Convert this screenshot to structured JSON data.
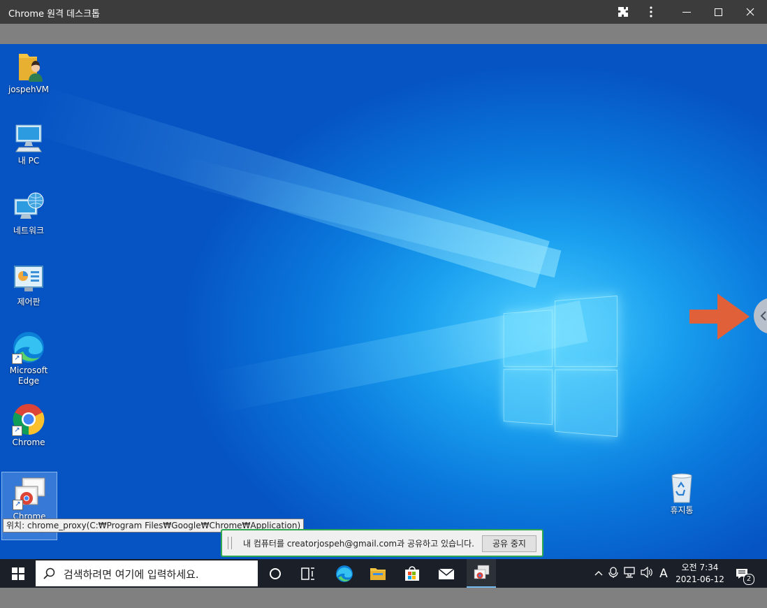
{
  "window": {
    "title": "Chrome 원격 데스크톱"
  },
  "desktop_icons": [
    {
      "label": "jospehVM"
    },
    {
      "label": "내 PC"
    },
    {
      "label": "네트워크"
    },
    {
      "label": "제어판"
    },
    {
      "label": "Microsoft Edge"
    },
    {
      "label": "Chrome"
    },
    {
      "label": "Chrome Desktop"
    },
    {
      "label": "휴지통"
    }
  ],
  "tooltip": {
    "text": "위치: chrome_proxy(C:₩Program Files₩Google₩Chrome₩Application)"
  },
  "share_bar": {
    "message": "내 컴퓨터를 creatorjospeh@gmail.com과 공유하고 있습니다.",
    "stop_label": "공유 중지"
  },
  "taskbar": {
    "search_placeholder": "검색하려면 여기에 입력하세요.",
    "ime": "A",
    "time": "오전 7:34",
    "date": "2021-06-12",
    "notification_count": "2"
  },
  "colors": {
    "arrow": "#e0603a",
    "share_border": "#2fa84f",
    "taskbar": "#1b2028"
  }
}
